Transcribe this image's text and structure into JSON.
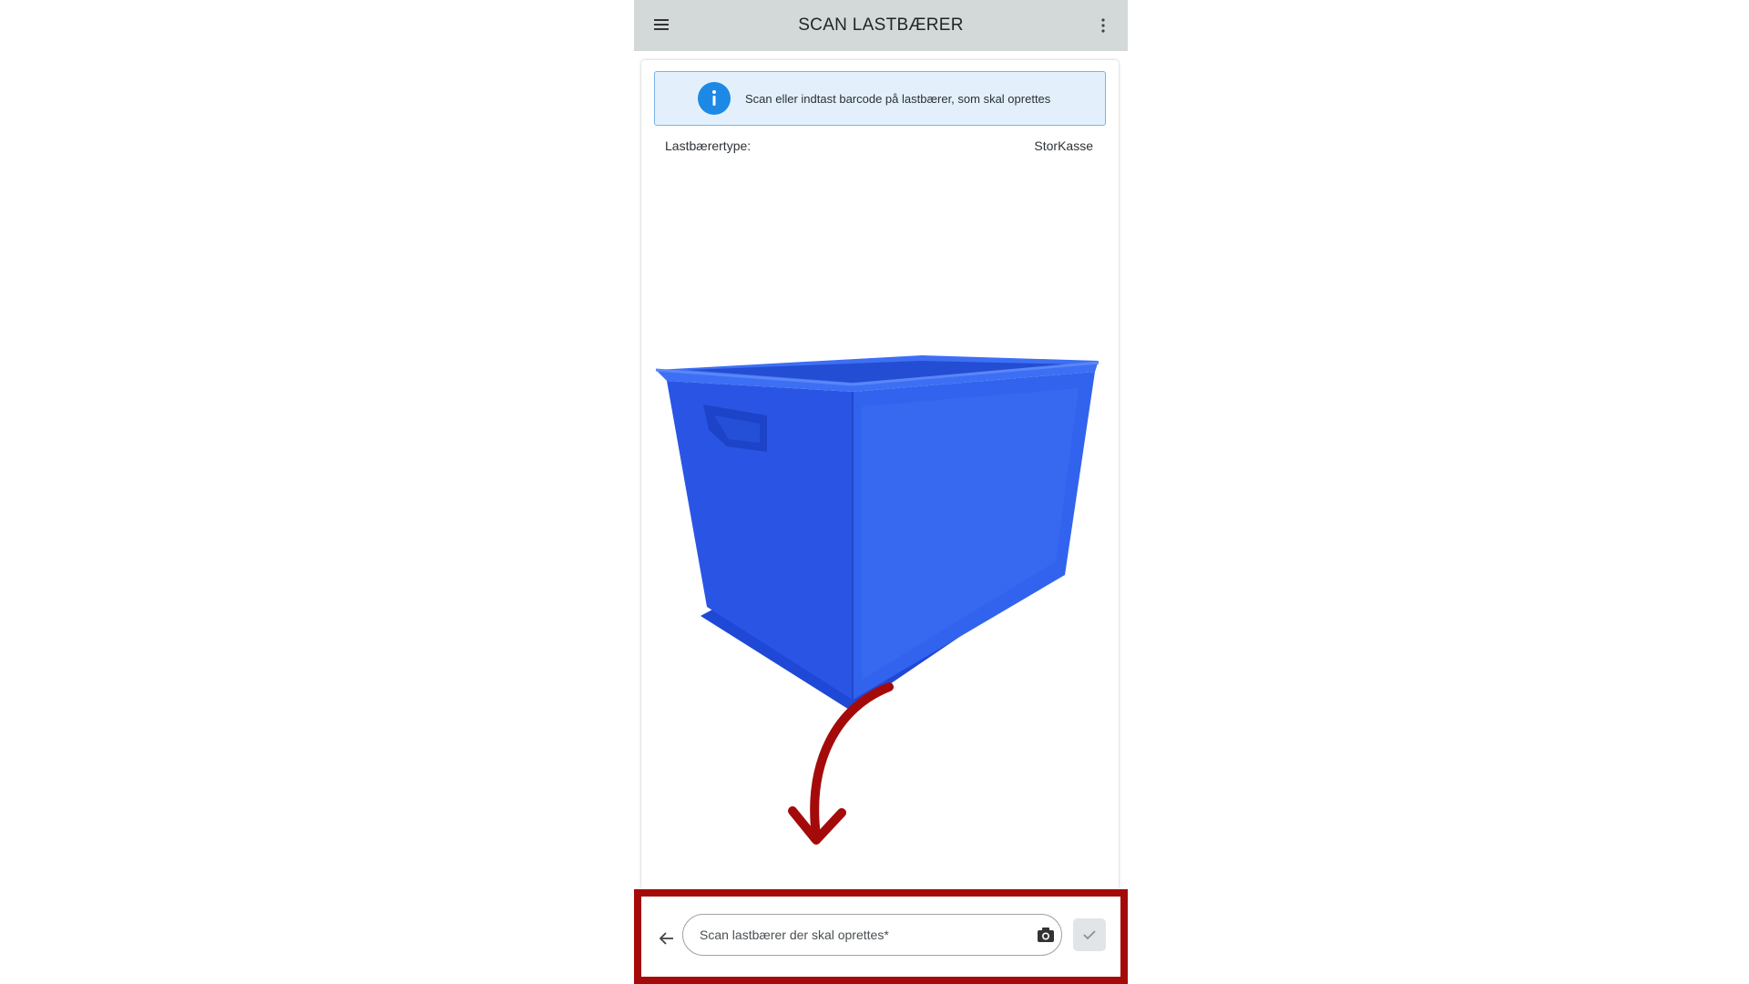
{
  "app": {
    "title": "SCAN LASTBÆRER"
  },
  "icons": {
    "menu": "menu-icon",
    "more": "more-vertical-icon",
    "info": "info-icon",
    "back": "arrow-left-icon",
    "camera": "camera-icon",
    "confirm": "check-icon"
  },
  "info_banner": {
    "text": "Scan eller indtast barcode på lastbærer, som skal oprettes"
  },
  "details": {
    "type_label": "Lastbærertype:",
    "type_value": "StorKasse"
  },
  "scan": {
    "placeholder": "Scan lastbærer der skal oprettes*",
    "value": ""
  },
  "colors": {
    "appbar": "#d3d9d8",
    "info_bg": "#e3f0fb",
    "info_border": "#7bb2e6",
    "info_icon": "#1e88e5",
    "highlight": "#a50a0a",
    "crate": "#2f5ee8"
  }
}
